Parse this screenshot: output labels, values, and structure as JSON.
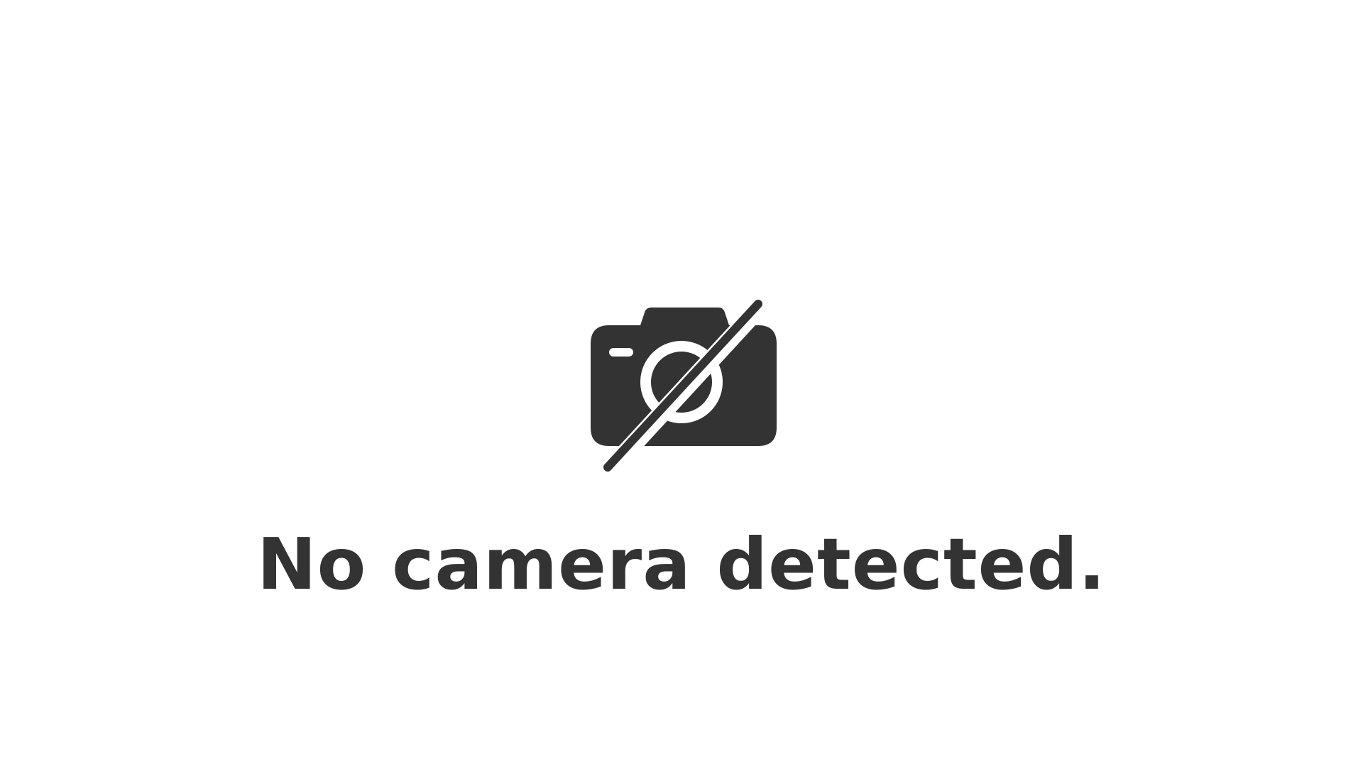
{
  "message": "No camera detected.",
  "icon": {
    "name": "no-camera-icon",
    "color": "#333333"
  },
  "colors": {
    "background": "#ffffff",
    "text": "#333333"
  }
}
